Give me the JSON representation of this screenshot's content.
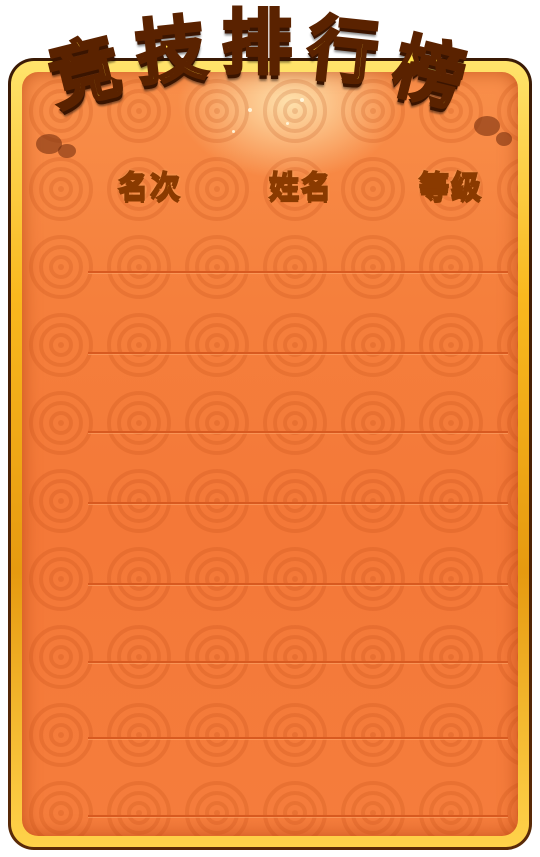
{
  "leaderboard": {
    "title_chars": [
      "竞",
      "技",
      "排",
      "行",
      "榜"
    ],
    "columns": {
      "rank": "名次",
      "name": "姓名",
      "level": "等级"
    }
  }
}
